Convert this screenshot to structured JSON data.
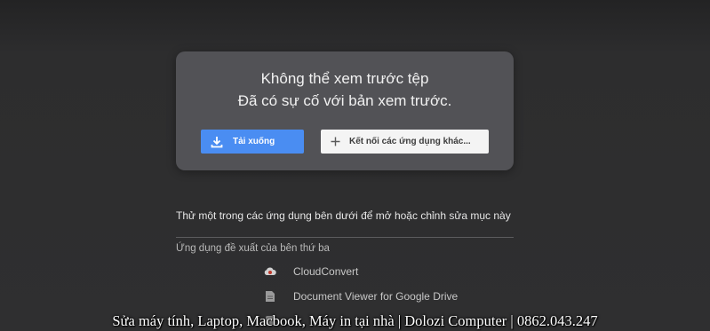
{
  "preview_error": {
    "title": "Không thể xem trước tệp",
    "message": "Đã có sự cố với bản xem trước.",
    "download_label": "Tải xuống",
    "connect_label": "Kết nối các ứng dụng khác..."
  },
  "open_with": {
    "heading": "Thử một trong các ứng dụng bên dưới để mở hoặc chỉnh sửa mục này",
    "subheading": "Ứng dụng đề xuất của bên thứ ba",
    "apps": [
      {
        "label": "CloudConvert",
        "icon": "cloud-convert-icon"
      },
      {
        "label": "Document Viewer for Google Drive",
        "icon": "document-icon"
      },
      {
        "label": "",
        "icon": "app-icon"
      }
    ]
  },
  "watermark": "Sửa máy tính, Laptop, Macbook, Máy in tại nhà | Dolozi Computer | 0862.043.247",
  "colors": {
    "background": "#2e2e2f",
    "card": "#525256",
    "primary": "#4a8df2",
    "secondary_button": "#f4f4f4"
  }
}
